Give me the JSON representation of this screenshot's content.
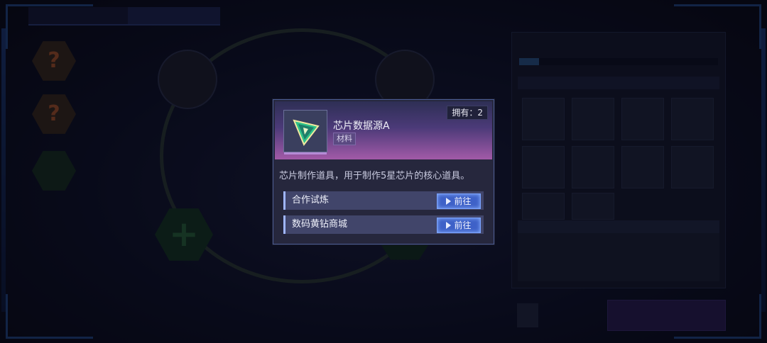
{
  "popup": {
    "owned_label": "拥有：2",
    "item_name": "芯片数据源A",
    "item_category": "材料",
    "description": "芯片制作道具，用于制作5星芯片的核心道具。",
    "routes": [
      {
        "label": "合作试炼",
        "button": "前往"
      },
      {
        "label": "数码黄钻商城",
        "button": "前往"
      }
    ]
  },
  "icons": {
    "item": "triangle-chip-icon",
    "go": "play-icon",
    "locked_slot": "question-mark-icon",
    "add_slot": "plus-icon"
  },
  "colors": {
    "accent_blue": "#3e61c8",
    "item_gradient_top": "#2e2f55",
    "item_gradient_bottom": "#a25aa8"
  }
}
